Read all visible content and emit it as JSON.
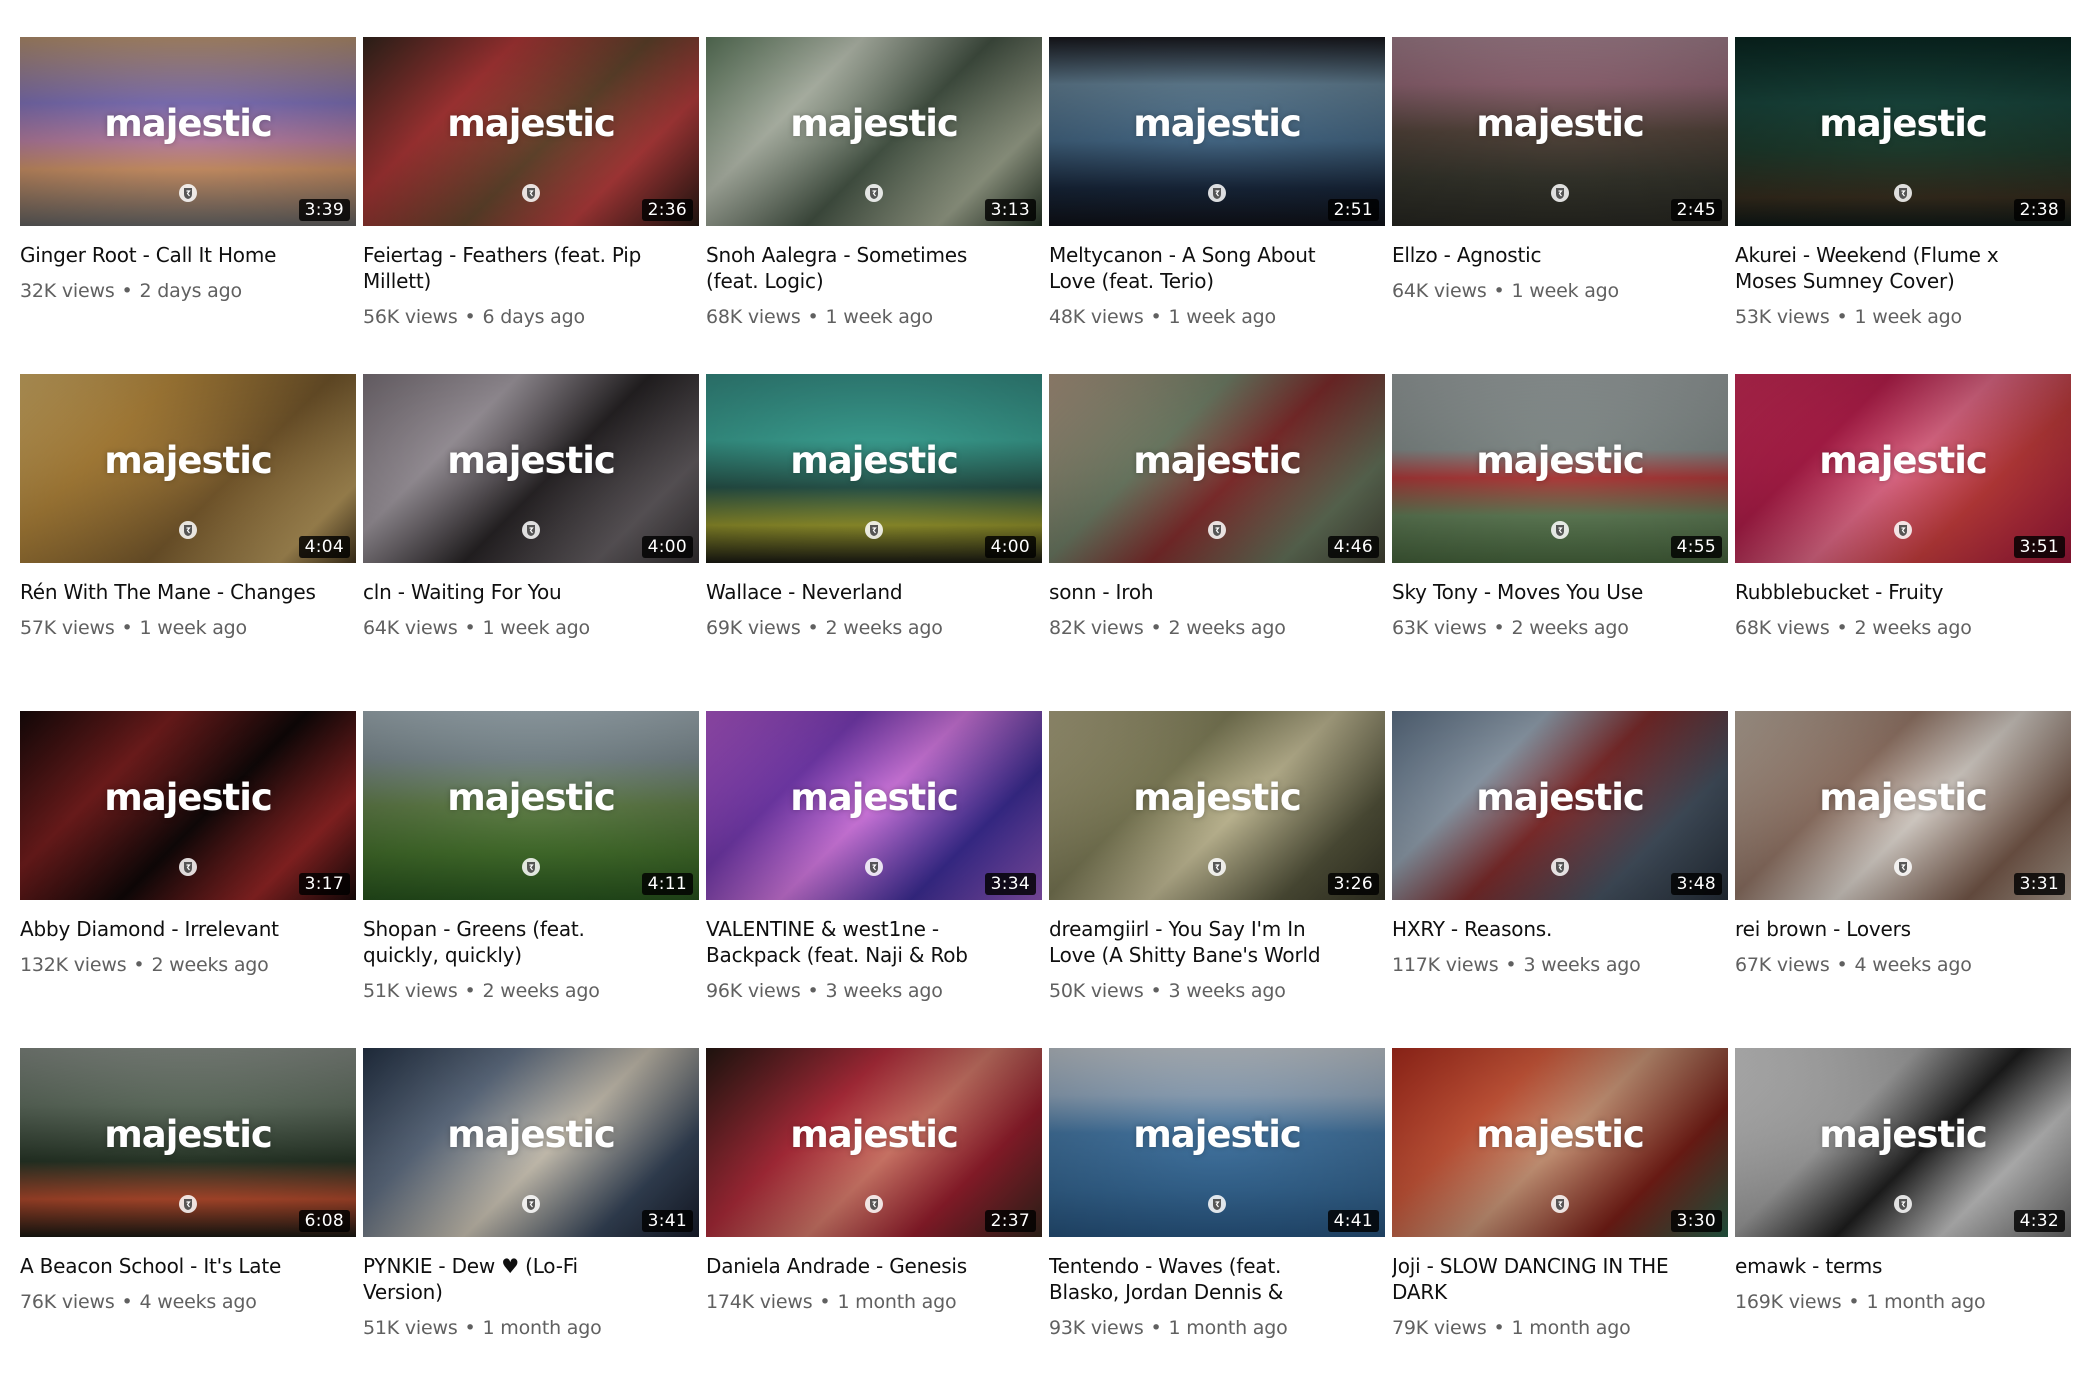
{
  "channel_wordmark": "majestic",
  "meta_separator": "•",
  "videos": [
    {
      "title": "Ginger Root - Call It Home",
      "views": "32K views",
      "age": "2 days ago",
      "duration": "3:39",
      "bg": "linear-gradient(180deg,#c8a07a 0%,#8a7bc8 35%,#c88ab0 55%,#e0a070 70%,#6a6a6a 100%)"
    },
    {
      "title": "Feiertag - Feathers (feat. Pip Millett)",
      "views": "56K views",
      "age": "6 days ago",
      "duration": "2:36",
      "bg": "linear-gradient(135deg,#3a2a20 0%,#b83a3a 30%,#6a4a30 55%,#c04040 75%,#2a1a14 100%)"
    },
    {
      "title": "Snoh Aalegra - Sometimes (feat. Logic)",
      "views": "68K views",
      "age": "1 week ago",
      "duration": "3:13",
      "bg": "linear-gradient(135deg,#6a8a6a 0%,#c8d0c0 30%,#4a5a4a 55%,#a8b098 80%,#2a3a2a 100%)"
    },
    {
      "title": "Meltycanon - A Song About Love (feat. Terio)",
      "views": "48K views",
      "age": "1 week ago",
      "duration": "2:51",
      "bg": "linear-gradient(180deg,#1a1a20 0%,#6a8aa0 25%,#4a7090 55%,#1a2a40 80%,#10121a 100%)"
    },
    {
      "title": "Ellzo - Agnostic",
      "views": "64K views",
      "age": "1 week ago",
      "duration": "2:45",
      "bg": "linear-gradient(180deg,#b08a98 0%,#a07080 25%,#5a4a40 50%,#3a3a30 75%,#2a2a24 100%)"
    },
    {
      "title": "Akurei - Weekend (Flume x Moses Sumney Cover)",
      "views": "53K views",
      "age": "1 week ago",
      "duration": "2:38",
      "bg": "linear-gradient(180deg,#0a2a24 0%,#1a4a40 35%,#204030 60%,#3a3020 85%,#101a18 100%)"
    },
    {
      "title": "Rén With The Mane - Changes",
      "views": "57K views",
      "age": "1 week ago",
      "duration": "4:04",
      "bg": "linear-gradient(135deg,#e8c070 0%,#c09040 30%,#806030 60%,#c0a060 85%,#4a3a20 100%)"
    },
    {
      "title": "cln - Waiting For You",
      "views": "64K views",
      "age": "1 week ago",
      "duration": "4:00",
      "bg": "linear-gradient(135deg,#8a8088 0%,#b0a8b0 30%,#2a2628 55%,#6a6468 80%,#3a3638 100%)"
    },
    {
      "title": "Wallace - Neverland",
      "views": "69K views",
      "age": "2 weeks ago",
      "duration": "4:00",
      "bg": "linear-gradient(180deg,#3a9a90 0%,#40b0a0 35%,#2a5a50 60%,#a0a030 80%,#1a1a14 100%)"
    },
    {
      "title": "sonn - Iroh",
      "views": "82K views",
      "age": "2 weeks ago",
      "duration": "4:46",
      "bg": "linear-gradient(135deg,#c0a890 0%,#7a8a70 35%,#8a3030 55%,#6a7a60 80%,#4a4a3a 100%)"
    },
    {
      "title": "Sky Tony - Moves You Use",
      "views": "63K views",
      "age": "2 weeks ago",
      "duration": "4:55",
      "bg": "linear-gradient(180deg,#a8b0b0 0%,#909a98 40%,#c04040 55%,#6a8a60 75%,#4a6a40 100%)"
    },
    {
      "title": "Rubblebucket - Fruity",
      "views": "68K views",
      "age": "2 weeks ago",
      "duration": "3:51",
      "bg": "linear-gradient(135deg,#e03060 0%,#c02050 30%,#f07090 50%,#d04040 70%,#b01840 100%)"
    },
    {
      "title": "Abby Diamond - Irrelevant",
      "views": "132K views",
      "age": "2 weeks ago",
      "duration": "3:17",
      "bg": "linear-gradient(135deg,#1a0a0a 0%,#802020 30%,#100808 55%,#a02828 80%,#1a0a0a 100%)"
    },
    {
      "title": "Shopan - Greens (feat. quickly, quickly)",
      "views": "51K views",
      "age": "2 weeks ago",
      "duration": "4:11",
      "bg": "linear-gradient(180deg,#b0c0c8 0%,#8a9aa0 25%,#6a8a50 50%,#4a7a30 75%,#2a5a20 100%)"
    },
    {
      "title": "VALENTINE & west1ne - Backpack (feat. Naji & Rob",
      "views": "96K views",
      "age": "3 weeks ago",
      "duration": "3:34",
      "bg": "linear-gradient(135deg,#c060e0 0%,#8040c0 30%,#e080f0 50%,#4030a0 75%,#a060d0 100%)"
    },
    {
      "title": "dreamgiirl - You Say I'm In Love (A Shitty Bane's World",
      "views": "50K views",
      "age": "3 weeks ago",
      "duration": "3:26",
      "bg": "linear-gradient(135deg,#c0b890 0%,#8a8860 35%,#d0c8a0 55%,#5a5a40 80%,#3a3a28 100%)"
    },
    {
      "title": "HXRY - Reasons.",
      "views": "117K views",
      "age": "3 weeks ago",
      "duration": "3:48",
      "bg": "linear-gradient(135deg,#6a8098 0%,#a0b0c0 30%,#8a3030 50%,#4a5868 75%,#2a3440 100%)"
    },
    {
      "title": "rei brown - Lovers",
      "views": "67K views",
      "age": "4 weeks ago",
      "duration": "3:31",
      "bg": "linear-gradient(135deg,#d0c0b0 0%,#a08070 35%,#e8e0d8 55%,#806050 80%,#c0b0a0 100%)"
    },
    {
      "title": "A Beacon School - It's Late",
      "views": "76K views",
      "age": "4 weeks ago",
      "duration": "6:08",
      "bg": "linear-gradient(180deg,#909890 0%,#6a7a6a 30%,#2a3a2a 60%,#c05030 80%,#1a1a14 100%)"
    },
    {
      "title": "PYNKIE - Dew ♥ (Lo-Fi Version)",
      "views": "51K views",
      "age": "1 month ago",
      "duration": "3:41",
      "bg": "linear-gradient(135deg,#2a3a50 0%,#6a7a90 30%,#d8d0c0 55%,#3a4a60 80%,#1a2030 100%)"
    },
    {
      "title": "Daniela Andrade - Genesis",
      "views": "174K views",
      "age": "1 month ago",
      "duration": "2:37",
      "bg": "linear-gradient(135deg,#2a1a14 0%,#c03040 35%,#e08070 55%,#a02030 75%,#3a2a20 100%)"
    },
    {
      "title": "Tentendo - Waves (feat. Blasko, Jordan Dennis &",
      "views": "93K views",
      "age": "1 month ago",
      "duration": "4:41",
      "bg": "linear-gradient(180deg,#d0d8e0 0%,#a0b8d0 25%,#4a80b0 45%,#3a70a0 75%,#2a5a88 100%)"
    },
    {
      "title": "Joji - SLOW DANCING IN THE DARK",
      "views": "79K views",
      "age": "1 month ago",
      "duration": "3:30",
      "bg": "linear-gradient(135deg,#c03020 0%,#e06040 30%,#d8a080 50%,#802018 75%,#2a6a50 100%)"
    },
    {
      "title": "emawk - terms",
      "views": "169K views",
      "age": "1 month ago",
      "duration": "4:32",
      "bg": "linear-gradient(135deg,#e8e8e8 0%,#b0b0b0 35%,#202020 55%,#d0d0d0 75%,#707070 100%)"
    }
  ]
}
